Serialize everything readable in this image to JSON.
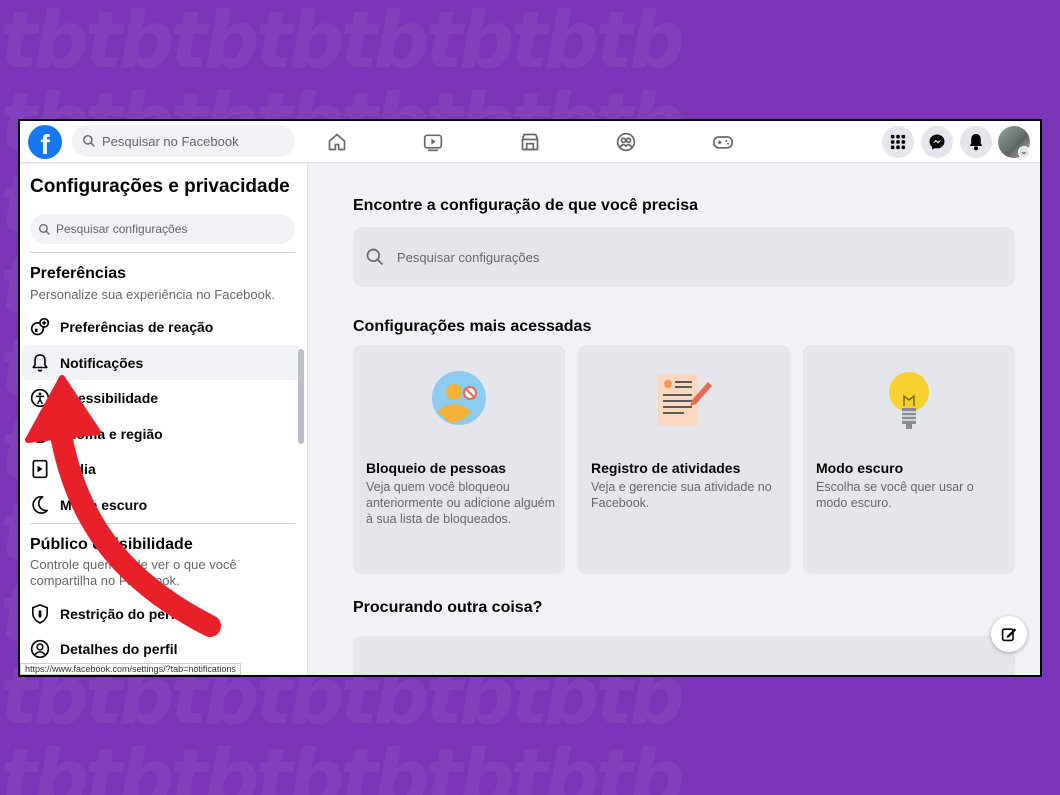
{
  "background": {
    "color": "#7a35b8",
    "watermark": "tbtbtbtbtbtbtbtb"
  },
  "topbar": {
    "logo": "f",
    "search_placeholder": "Pesquisar no Facebook",
    "nav_icons": [
      "home-icon",
      "watch-icon",
      "marketplace-icon",
      "groups-icon",
      "gaming-icon"
    ],
    "right_icons": [
      "menu-grid-icon",
      "messenger-icon",
      "bell-icon",
      "profile-avatar"
    ]
  },
  "sidebar": {
    "title": "Configurações e privacidade",
    "search_placeholder": "Pesquisar configurações",
    "preferences": {
      "title": "Preferências",
      "subtitle": "Personalize sua experiência no Facebook.",
      "items": [
        {
          "label": "Preferências de reação",
          "icon": "reaction-icon"
        },
        {
          "label": "Notificações",
          "icon": "bell-icon",
          "active": true
        },
        {
          "label": "Acessibilidade",
          "icon": "accessibility-icon"
        },
        {
          "label": "Idioma e região",
          "icon": "globe-icon"
        },
        {
          "label": "Mídia",
          "icon": "media-icon"
        },
        {
          "label": "Modo escuro",
          "icon": "moon-icon"
        }
      ]
    },
    "audience": {
      "title": "Público e visibilidade",
      "subtitle": "Controle quem pode ver o que você compartilha no Facebook.",
      "items": [
        {
          "label": "Restrição do perfil",
          "icon": "shield-icon"
        },
        {
          "label": "Detalhes do perfil",
          "icon": "user-circle-icon"
        }
      ]
    },
    "status_url": "https://www.facebook.com/settings/?tab=notifications"
  },
  "main": {
    "search_heading": "Encontre a configuração de que você precisa",
    "search_placeholder": "Pesquisar configurações",
    "popular_heading": "Configurações mais acessadas",
    "cards": [
      {
        "title": "Bloqueio de pessoas",
        "desc": "Veja quem você bloqueou anteriormente ou adicione alguém à sua lista de bloqueados."
      },
      {
        "title": "Registro de atividades",
        "desc": "Veja e gerencie sua atividade no Facebook."
      },
      {
        "title": "Modo escuro",
        "desc": "Escolha se você quer usar o modo escuro."
      }
    ],
    "other_heading": "Procurando outra coisa?"
  },
  "colors": {
    "brand": "#1877f2",
    "annotation_arrow": "#e8202a"
  }
}
